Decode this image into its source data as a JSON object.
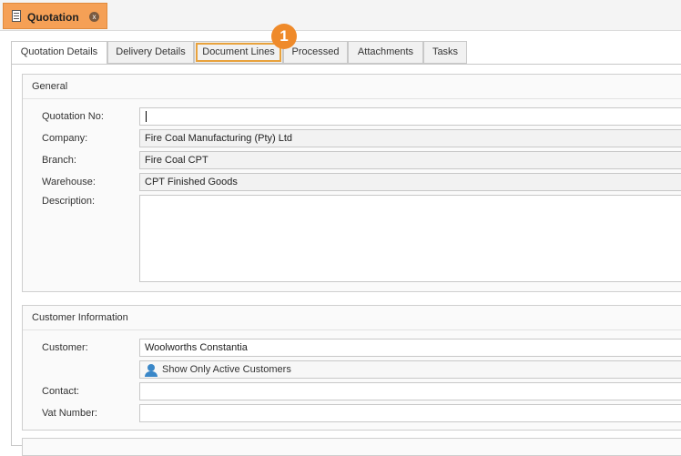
{
  "window": {
    "doc_tab_title": "Quotation",
    "close_glyph": "x"
  },
  "tabs": [
    "Quotation Details",
    "Delivery Details",
    "Document Lines",
    "Processed",
    "Attachments",
    "Tasks"
  ],
  "callout_number": "1",
  "general": {
    "title": "General",
    "quotation_no_label": "Quotation No:",
    "quotation_no_value": "",
    "company_label": "Company:",
    "company_value": "Fire Coal Manufacturing (Pty) Ltd",
    "branch_label": "Branch:",
    "branch_value": "Fire Coal CPT",
    "warehouse_label": "Warehouse:",
    "warehouse_value": "CPT Finished Goods",
    "description_label": "Description:",
    "description_value": ""
  },
  "customer_info": {
    "title": "Customer Information",
    "customer_label": "Customer:",
    "customer_value": "Woolworths Constantia",
    "active_only_label": "Show Only Active Customers",
    "contact_label": "Contact:",
    "contact_value": "",
    "vat_label": "Vat Number:",
    "vat_value": ""
  },
  "colors": {
    "accent": "#f5a056",
    "callout": "#ef8a2a",
    "highlight": "#e8a23c"
  },
  "icons": {
    "doc_tab": "document-icon",
    "close": "close-icon",
    "customers": "user-icon"
  }
}
